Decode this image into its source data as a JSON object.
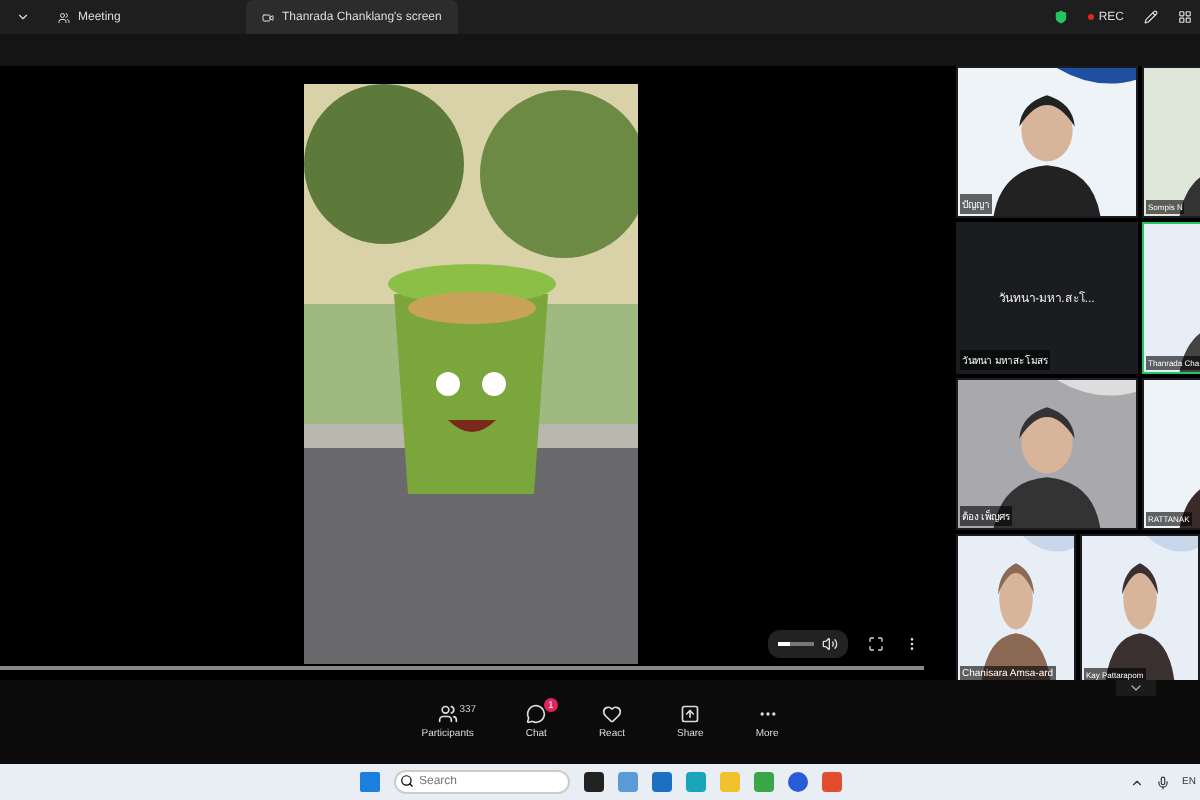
{
  "tabs": [
    {
      "label": "Meeting",
      "selected": false
    },
    {
      "label": "Thanrada Chanklang's screen",
      "selected": true
    }
  ],
  "top_actions": {
    "rec": "REC"
  },
  "shared_video": {
    "kind": "picture",
    "progress": {
      "level": 1
    },
    "volume": {
      "level": 0.35
    }
  },
  "gallery": [
    {
      "name": "ปัญญา",
      "kind": "video",
      "speaking": false
    },
    {
      "name": "Sompis N",
      "kind": "video",
      "speaking": false
    },
    {
      "name": "วันทนา มหาสะโมสร",
      "caption": "วันทนา-มหา.สะโ...",
      "kind": "name",
      "speaking": false
    },
    {
      "name": "Thanrada Cha",
      "kind": "video",
      "speaking": true
    },
    {
      "name": "ต้อง เพ็ญศร",
      "kind": "video",
      "speaking": false
    },
    {
      "name": "RATTANAK",
      "kind": "video",
      "speaking": false
    },
    {
      "name": "Chanisara Amsa-ard",
      "kind": "video",
      "speaking": false
    },
    {
      "name": "Kay Pattarapom",
      "kind": "video",
      "speaking": false
    }
  ],
  "toolbar": [
    {
      "label": "Participants",
      "count": "337",
      "kind": "people"
    },
    {
      "label": "Chat",
      "badge": "1",
      "kind": "chat"
    },
    {
      "label": "React",
      "kind": "heart"
    },
    {
      "label": "Share",
      "kind": "share"
    },
    {
      "label": "More",
      "kind": "more"
    }
  ],
  "taskbar": {
    "search": {
      "placeholder": "Search"
    },
    "language": "EN"
  }
}
